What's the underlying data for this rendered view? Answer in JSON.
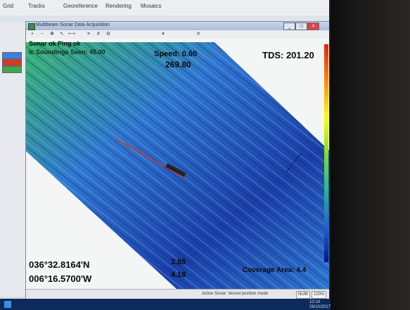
{
  "host": {
    "menu_tabs": [
      "Grid",
      "Tracks",
      "Georeference",
      "Rendering",
      "Mosaics"
    ],
    "swatch_colors": [
      "#3d7fe0",
      "#d43a2a",
      "#3fa84a"
    ]
  },
  "window": {
    "title": "Multibeam Sonar Data Acquisition",
    "toolbar_icons": [
      "zoom-in-icon",
      "zoom-out-icon",
      "pan-icon",
      "select-icon",
      "measure-icon",
      "layers-icon",
      "grid-icon",
      "settings-icon"
    ],
    "controls": {
      "minimize": "_",
      "maximize": "□",
      "close": "×"
    }
  },
  "overlay": {
    "status_line_1": "Sonar ok   Ping ok",
    "status_line_2": "ic Soundings Seen: 45.00",
    "speed": "Speed: 0.60",
    "heading": "269.80",
    "tds": "TDS: 201.20",
    "latitude": "036°32.8164'N",
    "longitude": "006°16.5700'W",
    "value_a": "3.55",
    "value_b": "4.18",
    "coverage": "Coverage Area: 4.4"
  },
  "statusbar": {
    "text": "Active Sonar: Vessel position mode",
    "cells": [
      "NUM",
      "100%"
    ]
  },
  "taskbar": {
    "clock": "10:14",
    "date": "26/10/2017"
  },
  "colors": {
    "swath_deep": "#1b3fa8",
    "swath_mid": "#2f77d0",
    "swath_shallow": "#39b66b",
    "track_line": "#d8342c"
  }
}
